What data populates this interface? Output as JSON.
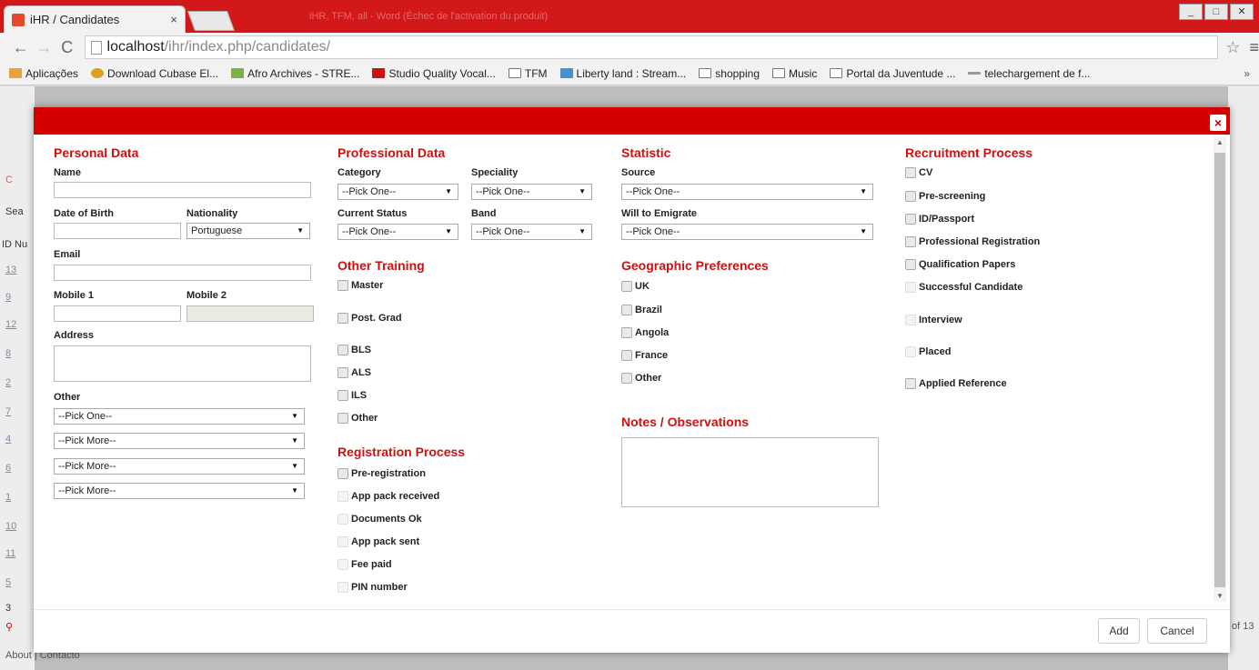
{
  "browser": {
    "tab_title": "iHR / Candidates",
    "tab_close": "×",
    "other_tab": "iHR, TFM, all - Word (Échec de l'activation du produit)",
    "url_host": "localhost",
    "url_path": "/ihr/index.php/candidates/",
    "bookmarks": [
      "Aplicações",
      "Download Cubase El...",
      "Afro Archives - STRE...",
      "Studio Quality Vocal...",
      "TFM",
      "Liberty land : Stream...",
      "shopping",
      "Music",
      "Portal da Juventude ...",
      "telechargement de f..."
    ],
    "more": "»"
  },
  "background": {
    "ids": [
      "13",
      "9",
      "12",
      "8",
      "2",
      "7",
      "4",
      "6",
      "1",
      "10",
      "11",
      "5",
      "3"
    ],
    "left_labels": [
      "C",
      "Sea",
      "ID Nu"
    ],
    "pagination": "of 13",
    "footer": "About | Contacto"
  },
  "modal": {
    "close": "×",
    "personal": {
      "title": "Personal Data",
      "name": "Name",
      "dob": "Date of Birth",
      "nationality": "Nationality",
      "nationality_value": "Portuguese",
      "email": "Email",
      "mobile1": "Mobile 1",
      "mobile2": "Mobile 2",
      "address": "Address",
      "other": "Other",
      "other_selects": [
        "--Pick One--",
        "--Pick More--",
        "--Pick More--",
        "--Pick More--"
      ]
    },
    "professional": {
      "title": "Professional Data",
      "category": "Category",
      "speciality": "Speciality",
      "current_status": "Current Status",
      "band": "Band",
      "pick": "--Pick One--",
      "training_title": "Other Training",
      "training": [
        "Master",
        "Post. Grad",
        "BLS",
        "ALS",
        "ILS",
        "Other"
      ],
      "registration_title": "Registration Process",
      "registration": [
        "Pre-registration",
        "App pack received",
        "Documents Ok",
        "App pack sent",
        "Fee paid",
        "PIN number"
      ]
    },
    "statistic": {
      "title": "Statistic",
      "source": "Source",
      "emigrate": "Will to Emigrate",
      "pick": "--Pick One--",
      "geo_title": "Geographic Preferences",
      "geo": [
        "UK",
        "Brazil",
        "Angola",
        "France",
        "Other"
      ],
      "notes_title": "Notes / Observations"
    },
    "recruitment": {
      "title": "Recruitment Process",
      "items": [
        "CV",
        "Pre-screening",
        "ID/Passport",
        "Professional Registration",
        "Qualification Papers",
        "Successful Candidate",
        "Interview",
        "Placed",
        "Applied Reference"
      ]
    },
    "add": "Add",
    "cancel": "Cancel"
  }
}
